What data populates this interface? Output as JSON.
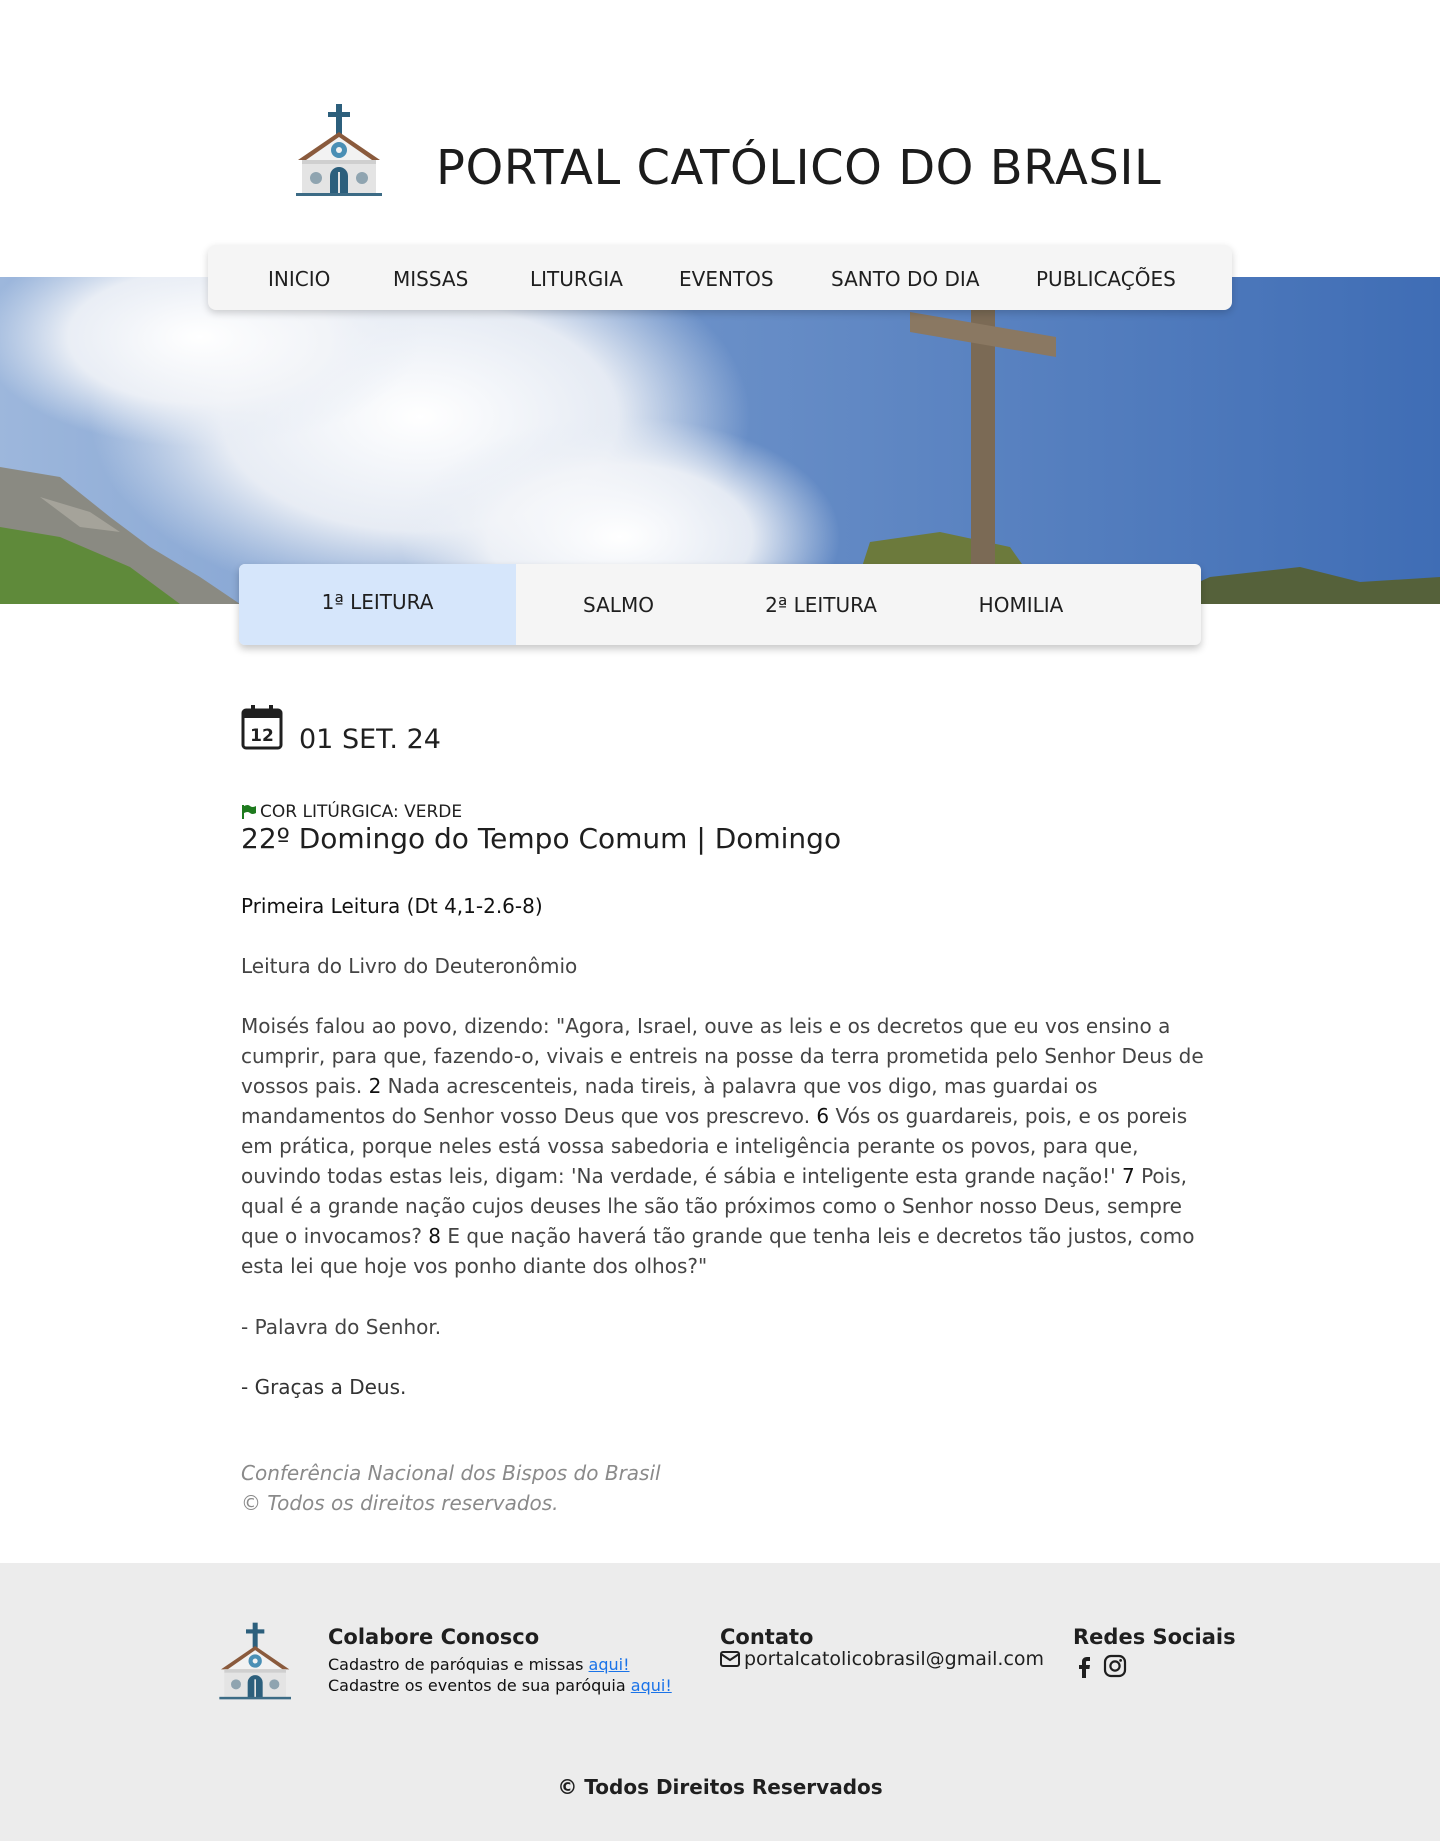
{
  "header": {
    "title": "PORTAL CATÓLICO DO BRASIL",
    "logo_icon": "church-icon"
  },
  "nav": {
    "items": [
      "INICIO",
      "MISSAS",
      "LITURGIA",
      "EVENTOS",
      "SANTO DO DIA",
      "PUBLICAÇÕES"
    ]
  },
  "hero": {
    "image": "cross-on-mountain-sky"
  },
  "tabs": {
    "items": [
      "1ª LEITURA",
      "SALMO",
      "2ª LEITURA",
      "HOMILIA"
    ],
    "active": "1ª LEITURA",
    "active_color": "#d6e6fb"
  },
  "content": {
    "calendar_icon_text": "12",
    "date": "01 SET. 24",
    "liturgical_color_label": "COR LITÚRGICA: VERDE",
    "liturgical_color": "#1e7a1e",
    "day_title": "22º Domingo do Tempo Comum | Domingo",
    "reading_title": "Primeira Leitura (Dt 4,1-2.6-8)",
    "book": "Leitura do Livro do Deuteronômio",
    "body": {
      "p1": "Moisés falou ao povo, dizendo: \"Agora, Israel, ouve as leis e os decretos que eu vos ensino a cumprir, para que, fazendo-o, vivais e entreis na posse da terra prometida pelo Senhor Deus de vossos pais. ",
      "v2": "2",
      "p2": " Nada acrescenteis, nada tireis, à palavra que vos digo, mas guardai os mandamentos do Senhor vosso Deus que vos prescrevo. ",
      "v6": "6",
      "p3": " Vós os guardareis, pois, e os poreis em prática, porque neles está vossa sabedoria e inteligência perante os povos, para que, ouvindo todas estas leis, digam: 'Na verdade, é sábia e inteligente esta grande nação!' ",
      "v7": "7",
      "p4": " Pois, qual é a grande nação cujos deuses lhe são tão próximos como o Senhor nosso Deus, sempre que o invocamos? ",
      "v8": "8",
      "p5": " E que nação haverá tão grande que tenha leis e decretos tão justos, como esta lei que hoje vos ponho diante dos olhos?\""
    },
    "palavra": "- Palavra do Senhor.",
    "resposta": "- Graças a Deus.",
    "source_line1": "Conferência Nacional dos Bispos do Brasil",
    "source_line2": "© Todos os direitos reservados."
  },
  "footer": {
    "colabore": {
      "title": "Colabore Conosco",
      "line1": "Cadastro de paróquias e missas ",
      "line2": "Cadastre os eventos de sua paróquia ",
      "link": "aqui!"
    },
    "contato": {
      "title": "Contato",
      "email": "portalcatolicobrasil@gmail.com"
    },
    "redes": {
      "title": "Redes Sociais",
      "icons": [
        "facebook-icon",
        "instagram-icon"
      ]
    },
    "copyright": "© Todos Direitos Reservados",
    "link_color": "#1a73e8",
    "background": "#ececec"
  }
}
